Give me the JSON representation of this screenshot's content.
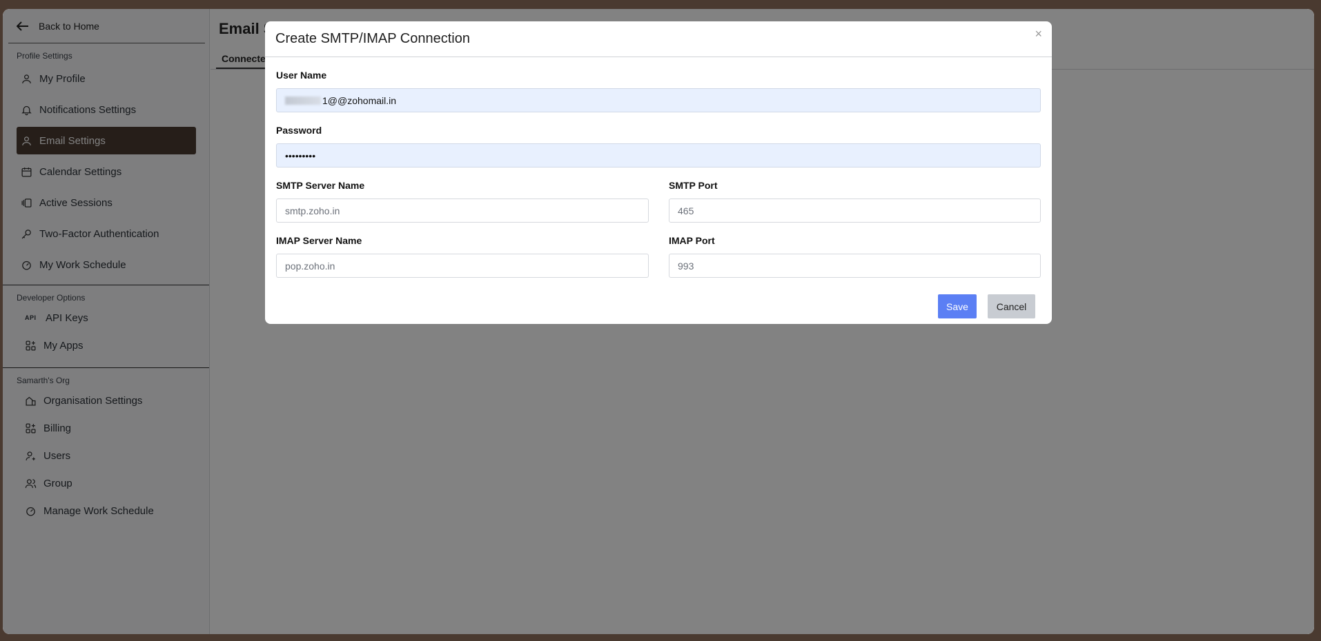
{
  "sidebar": {
    "back_label": "Back to Home",
    "sections": {
      "profile": "Profile Settings",
      "developer": "Developer Options",
      "org": "Samarth's Org"
    },
    "items": {
      "my_profile": "My Profile",
      "notifications": "Notifications Settings",
      "email": "Email Settings",
      "calendar": "Calendar Settings",
      "sessions": "Active Sessions",
      "two_factor": "Two-Factor Authentication",
      "work_schedule": "My Work Schedule",
      "api_keys": "API Keys",
      "api_glyph": "API",
      "my_apps": "My Apps",
      "org_settings": "Organisation Settings",
      "billing": "Billing",
      "users": "Users",
      "group": "Group",
      "manage_schedule": "Manage Work Schedule"
    }
  },
  "main": {
    "title": "Email S",
    "tab": "Connecte"
  },
  "modal": {
    "title": "Create SMTP/IMAP Connection",
    "close": "×",
    "username_label": "User Name",
    "username_value": "1@@zohomail.in",
    "password_label": "Password",
    "password_value": "•••••••••",
    "smtp_server_label": "SMTP Server Name",
    "smtp_server_placeholder": "smtp.zoho.in",
    "smtp_port_label": "SMTP Port",
    "smtp_port_placeholder": "465",
    "imap_server_label": "IMAP Server Name",
    "imap_server_placeholder": "pop.zoho.in",
    "imap_port_label": "IMAP Port",
    "imap_port_placeholder": "993",
    "save_label": "Save",
    "cancel_label": "Cancel"
  },
  "colors": {
    "accent": "#5b7ff4",
    "active_nav": "#4b3b31",
    "frame_bg": "#4a3a30"
  }
}
